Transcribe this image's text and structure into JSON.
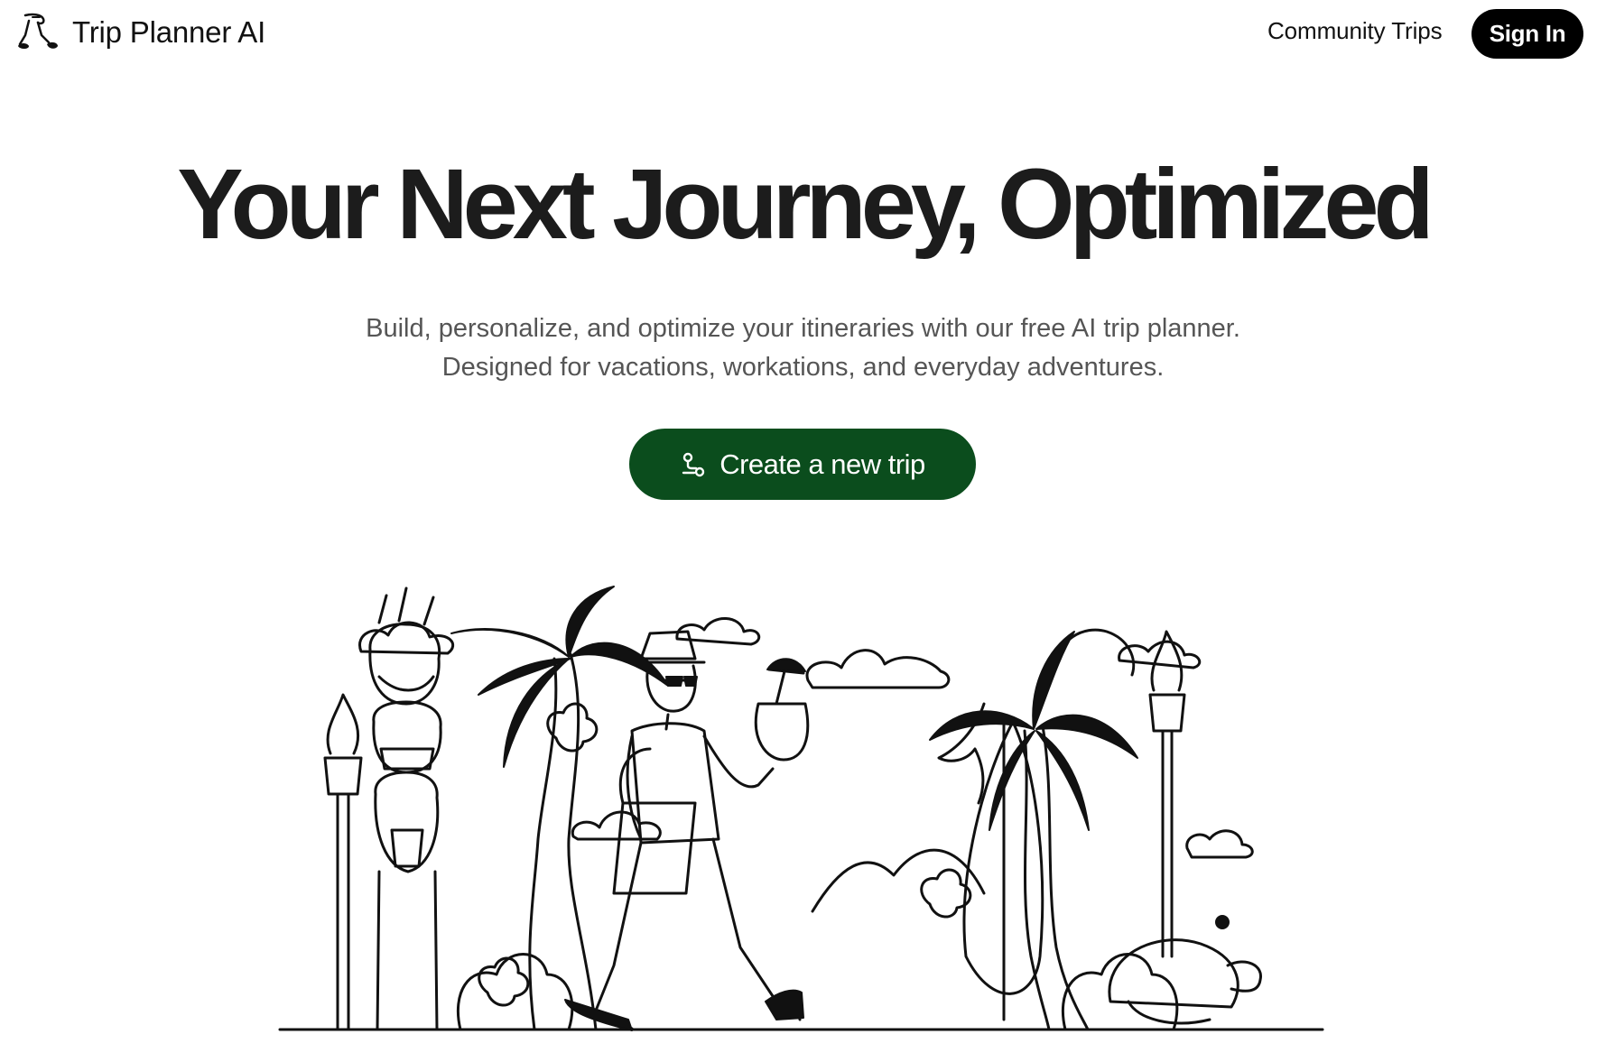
{
  "header": {
    "brand_name": "Trip Planner AI",
    "nav_link": "Community Trips",
    "signin_label": "Sign In"
  },
  "hero": {
    "title": "Your Next Journey, Optimized",
    "subtitle": "Build, personalize, and optimize your itineraries with our free AI trip planner. Designed for vacations, workations, and everyday adventures.",
    "cta_label": "Create a new trip",
    "cta_icon": "route-icon"
  },
  "colors": {
    "cta_background": "#0b4d1d",
    "signin_background": "#000000",
    "subtitle_text": "#555555",
    "title_text": "#1c1c1c"
  },
  "illustration": {
    "icon": "tropical-traveler-illustration"
  }
}
